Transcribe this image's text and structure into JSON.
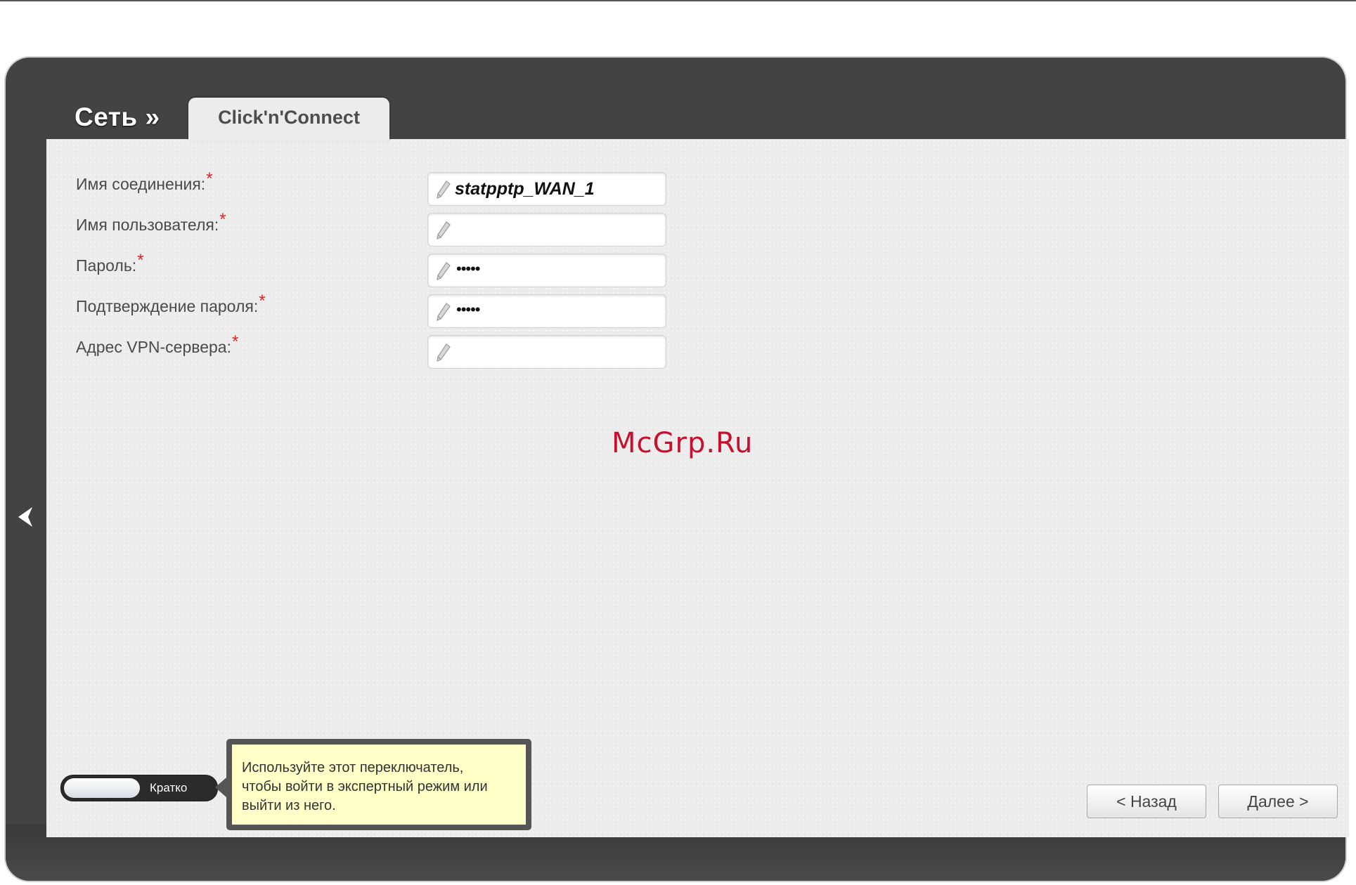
{
  "header": {
    "section": "Сеть »",
    "tab": "Click'n'Connect"
  },
  "form": {
    "fields": [
      {
        "label": "Имя соединения:",
        "required": "*",
        "value": "statpptp_WAN_1",
        "type": "text"
      },
      {
        "label": "Имя пользователя:",
        "required": "*",
        "value": "",
        "type": "text"
      },
      {
        "label": "Пароль:",
        "required": "*",
        "value": "•••••",
        "type": "password"
      },
      {
        "label": "Подтверждение пароля:",
        "required": "*",
        "value": "•••••",
        "type": "password"
      },
      {
        "label": "Адрес VPN-сервера:",
        "required": "*",
        "value": "",
        "type": "text"
      }
    ]
  },
  "watermark": "McGrp.Ru",
  "mode_toggle": {
    "label": "Кратко"
  },
  "tooltip": {
    "text_line1": "Используйте этот переключатель,",
    "text_line2": "чтобы войти в экспертный режим или",
    "text_line3": "выйти из него."
  },
  "buttons": {
    "back": "< Назад",
    "next": "Далее >"
  },
  "icons": {
    "side_nav": "chevron-left-icon",
    "field": "pencil-icon"
  },
  "colors": {
    "frame": "#434343",
    "content": "#ececec",
    "required": "#e02020",
    "watermark": "#c8102e",
    "tooltip_bg": "#ffffc8"
  }
}
